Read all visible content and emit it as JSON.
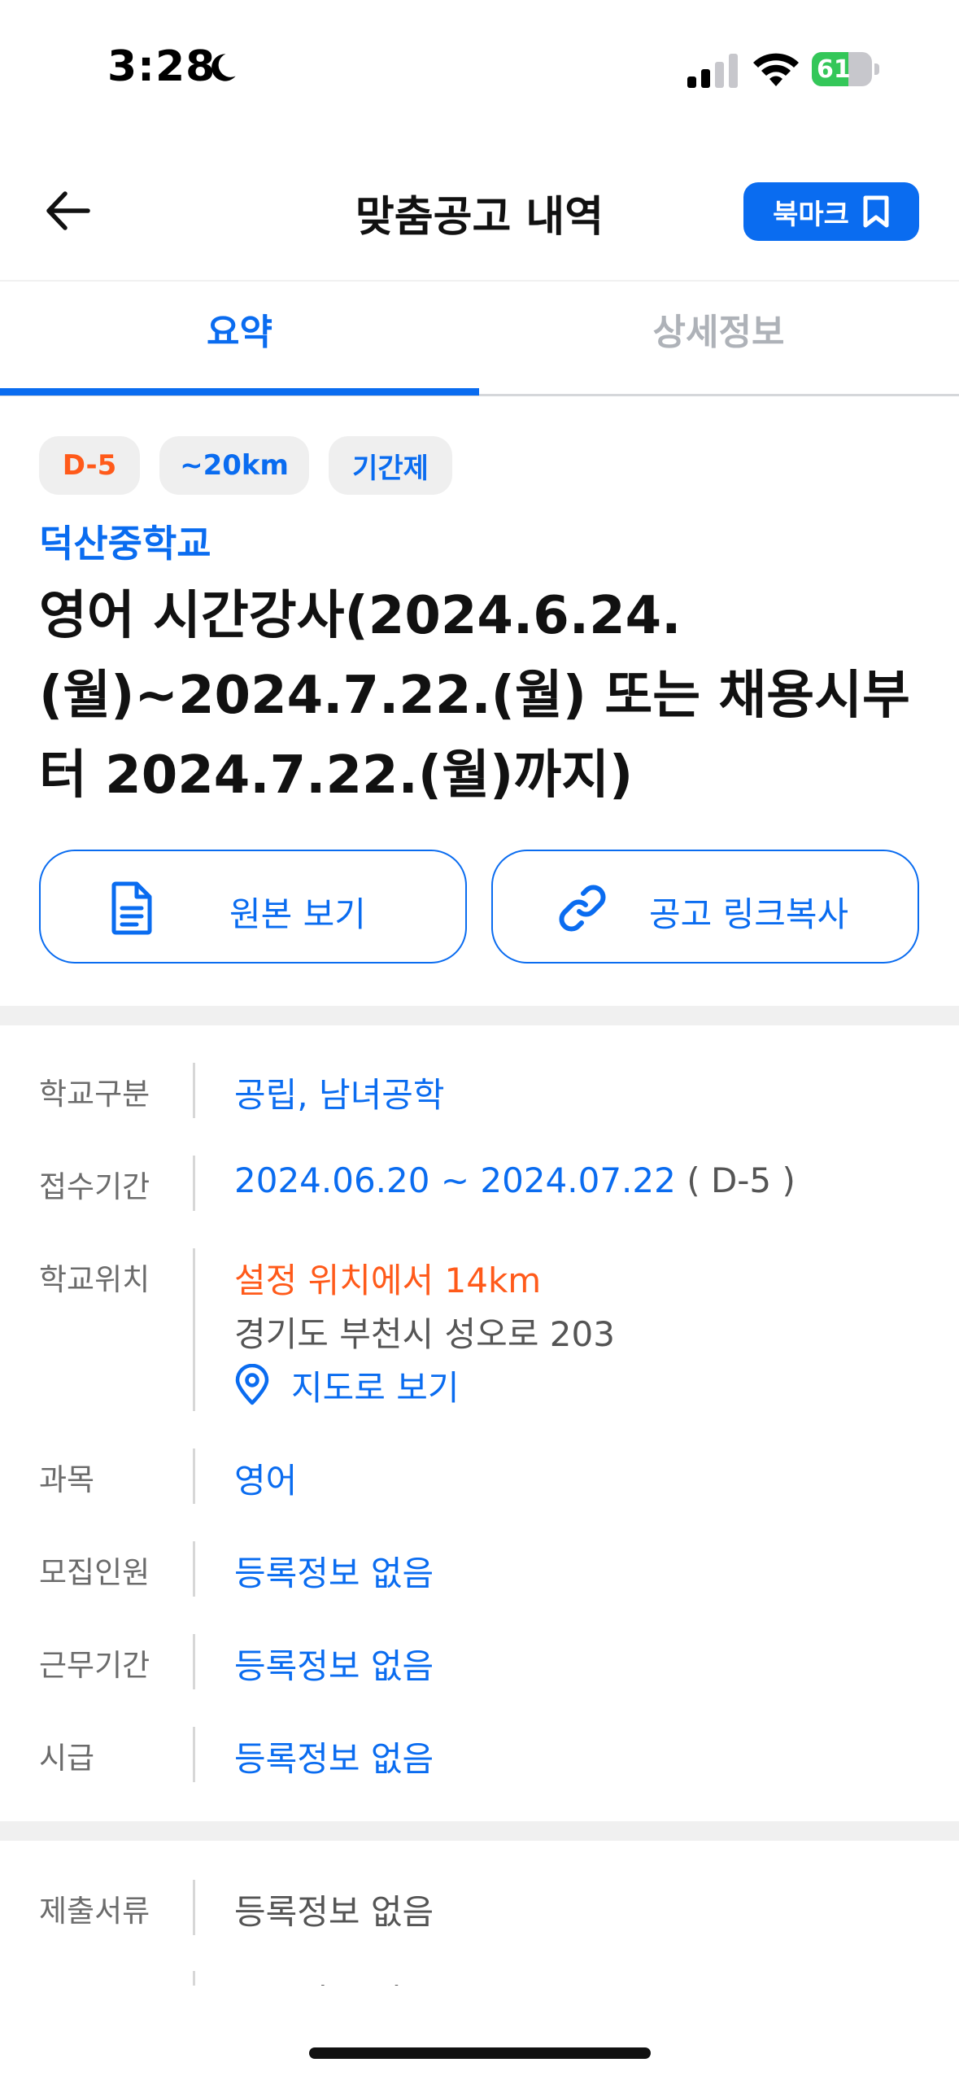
{
  "status_bar": {
    "time": "3:28",
    "battery": "61",
    "battery_level": 0.61
  },
  "header": {
    "title": "맞춤공고 내역",
    "bookmark_label": "북마크"
  },
  "tabs": [
    {
      "label": "요약",
      "active": true
    },
    {
      "label": "상세정보",
      "active": false
    }
  ],
  "chips": [
    "D-5",
    "~20km",
    "기간제"
  ],
  "school_name": "덕산중학교",
  "job_title": "영어 시간강사(2024.6.24.(월)~2024.7.22.(월) 또는 채용시부터 2024.7.22.(월)까지)",
  "actions": {
    "original_label": "원본 보기",
    "link_label": "공고 링크복사"
  },
  "info": {
    "school_type": {
      "label": "학교구분",
      "value": "공립, 남녀공학"
    },
    "period": {
      "label": "접수기간",
      "value": "2024.06.20 ~ 2024.07.22",
      "dday": "( D-5 )"
    },
    "location": {
      "label": "학교위치",
      "distance": "설정 위치에서 14km",
      "address": "경기도 부천시 성오로 203",
      "map_label": "지도로 보기"
    },
    "subject": {
      "label": "과목",
      "value": "영어"
    },
    "headcount": {
      "label": "모집인원",
      "value": "등록정보 없음"
    },
    "work_period": {
      "label": "근무기간",
      "value": "등록정보 없음"
    },
    "hourly_wage": {
      "label": "시급",
      "value": "등록정보 없음"
    }
  },
  "info2": {
    "documents": {
      "label": "제출서류",
      "value": "등록정보 없음"
    },
    "hiring_method": {
      "label": "채용방법",
      "value": "등록정보 없음"
    }
  },
  "colors": {
    "accent": "#0a6cf0",
    "warning": "#ff5a1a"
  }
}
